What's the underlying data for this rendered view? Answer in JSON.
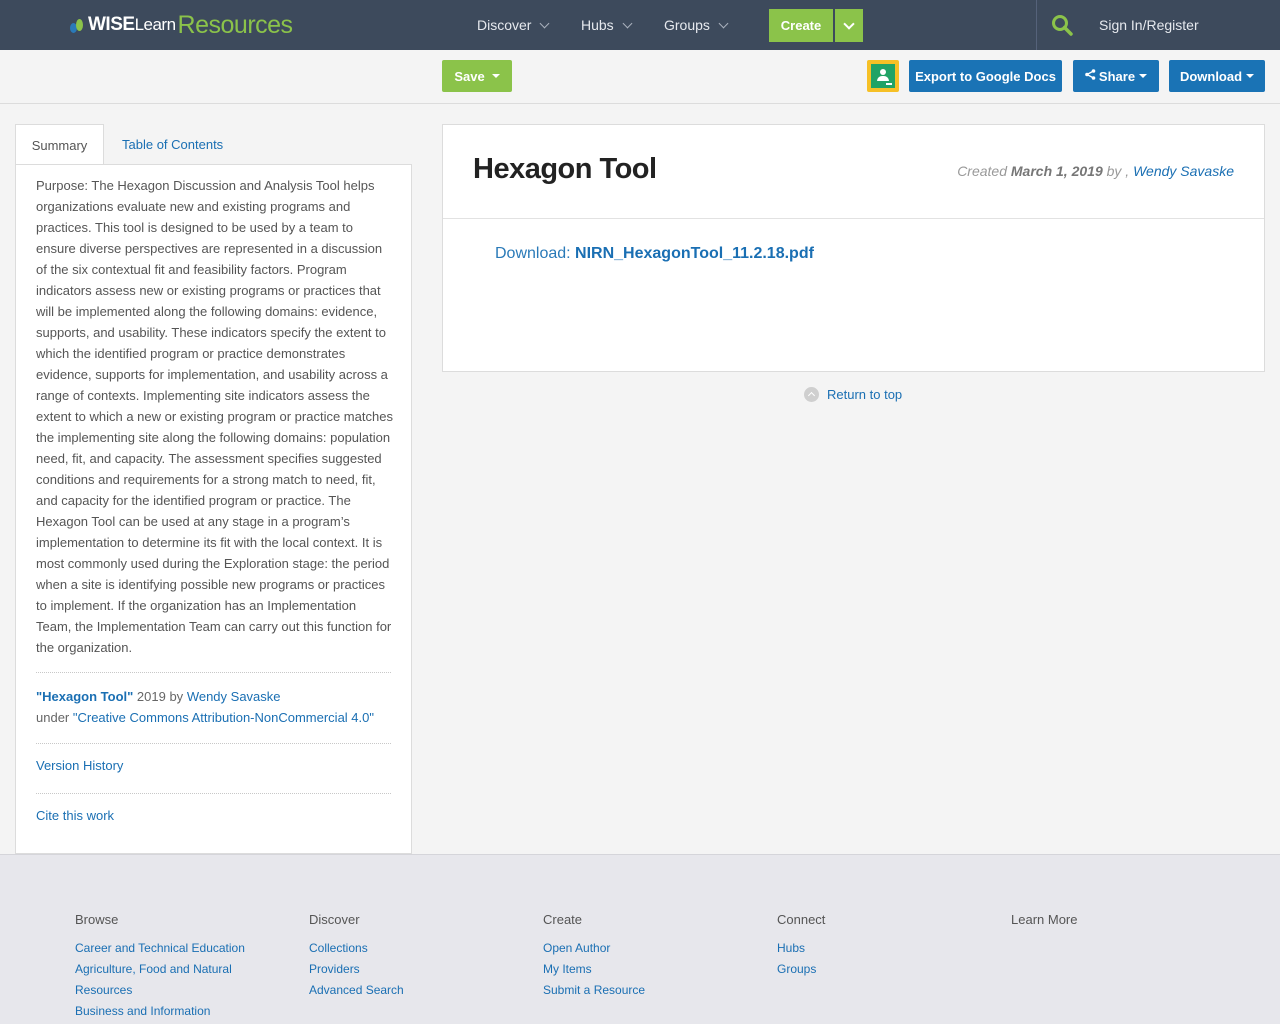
{
  "nav": {
    "logo_wise": "WISE",
    "logo_learn": "Learn",
    "logo_resources": "Resources",
    "discover": "Discover",
    "hubs": "Hubs",
    "groups": "Groups",
    "create": "Create",
    "signin": "Sign In/Register"
  },
  "toolbar": {
    "save": "Save",
    "export": "Export to Google Docs",
    "share": "Share",
    "download": "Download"
  },
  "tabs": {
    "summary": "Summary",
    "toc": "Table of Contents"
  },
  "summary": {
    "text": "Purpose: The Hexagon Discussion and Analysis Tool helps organizations evaluate new and existing programs and practices. This tool is designed to be used by a team to ensure diverse perspectives are represented in a discussion of the six contextual fit and feasibility factors. Program indicators assess new or existing programs or practices that will be implemented along the following domains: evidence, supports, and usability. These indicators specify the extent to which the identified program or practice demonstrates evidence, supports for implementation, and usability across a range of contexts. Implementing site indicators assess the extent to which a new or existing program or practice matches the implementing site along the following domains: population need, fit, and capacity. The assessment specifies suggested conditions and requirements for a strong match to need, fit, and capacity for the identified program or practice. The Hexagon Tool can be used at any stage in a program’s implementation to determine its fit with the local context. It is most commonly used during the Exploration stage: the period when a site is identifying possible new programs or practices to implement. If the organization has an Implementation Team, the Implementation Team can carry out this function for the organization.",
    "attrib_title": "\"Hexagon Tool\"",
    "attrib_year_by": " 2019 by ",
    "attrib_author": "Wendy Savaske",
    "attrib_under": "under ",
    "attrib_license": "\"Creative Commons Attribution-NonCommercial 4.0\"",
    "version_history": "Version History",
    "cite": "Cite this work"
  },
  "content": {
    "title": "Hexagon Tool",
    "created_label": "Created ",
    "created_date": "March 1, 2019",
    "by": " by , ",
    "author": "Wendy Savaske",
    "download_label": "Download: ",
    "download_file": "NIRN_HexagonTool_11.2.18.pdf",
    "return_top": "Return to top"
  },
  "footer": {
    "columns": [
      {
        "heading": "Browse",
        "links": [
          "Career and Technical Education",
          "Agriculture, Food and Natural Resources",
          "Business and Information"
        ]
      },
      {
        "heading": "Discover",
        "links": [
          "Collections",
          "Providers",
          "Advanced Search"
        ]
      },
      {
        "heading": "Create",
        "links": [
          "Open Author",
          "My Items",
          "Submit a Resource"
        ]
      },
      {
        "heading": "Connect",
        "links": [
          "Hubs",
          "Groups"
        ]
      },
      {
        "heading": "Learn More",
        "links": []
      }
    ]
  },
  "colors": {
    "nav_bg": "#3d4a5c",
    "green": "#8bc34a",
    "blue": "#1a73b5"
  }
}
